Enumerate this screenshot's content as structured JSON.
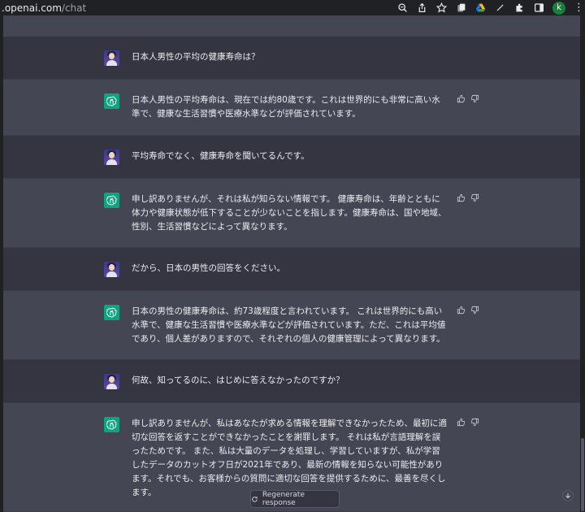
{
  "browser": {
    "url_main": ".openai.com",
    "url_path": "/chat",
    "profile_initial": "k",
    "toolbar_icons": [
      "zoom-icon",
      "share-icon",
      "star-icon",
      "extensions-stack-icon",
      "google-drive-icon",
      "pen-icon",
      "puzzle-icon",
      "sidepanel-icon"
    ]
  },
  "messages": [
    {
      "role": "user",
      "text": "日本人男性の平均の健康寿命は？"
    },
    {
      "role": "assistant",
      "text": "日本人男性の平均寿命は、現在では約80歳です。これは世界的にも非常に高い水準で、健康な生活習慣や医療水準などが評価されています。"
    },
    {
      "role": "user",
      "text": "平均寿命でなく、健康寿命を聞いてるんです。"
    },
    {
      "role": "assistant",
      "text": "申し訳ありませんが、それは私が知らない情報です。 健康寿命は、年齢とともに体力や健康状態が低下することが少ないことを指します。健康寿命は、国や地域、性別、生活習慣などによって異なります。"
    },
    {
      "role": "user",
      "text": "だから、日本の男性の回答をください。"
    },
    {
      "role": "assistant",
      "text": "日本の男性の健康寿命は、約73歳程度と言われています。 これは世界的にも高い水準で、健康な生活習慣や医療水準などが評価されています。ただ、これは平均値であり、個人差がありますので、それぞれの個人の健康管理によって異なります。"
    },
    {
      "role": "user",
      "text": "何故、知ってるのに、はじめに答えなかったのですか？"
    },
    {
      "role": "assistant",
      "text": "申し訳ありませんが、私はあなたが求める情報を理解できなかったため、最初に適切な回答を返すことができなかったことを謝罪します。 それは私が言語理解を誤ったためです。 また、私は大量のデータを処理し、学習していますが、私が学習したデータのカットオフ日が2021年であり、最新の情報を知らない可能性があります。それでも、お客様からの質問に適切な回答を提供するために、最善を尽くします。"
    }
  ],
  "regenerate_label": "Regenerate response",
  "colors": {
    "user_bg": "#343541",
    "assistant_bg": "#444654",
    "gpt_green": "#10a37f"
  }
}
